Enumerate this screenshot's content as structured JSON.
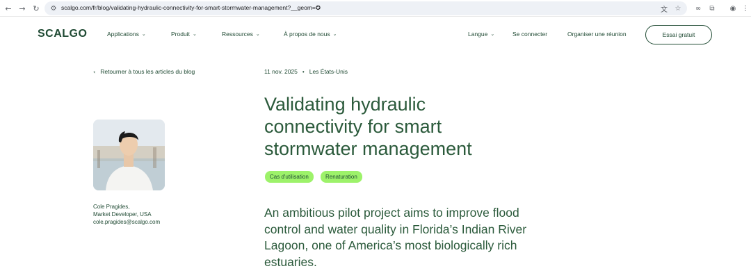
{
  "browser": {
    "url": "scalgo.com/fr/blog/validating-hydraulic-connectivity-for-smart-stormwater-management?__geom=✪",
    "icons": [
      "back-icon",
      "forward-icon",
      "reload-icon",
      "tune-icon",
      "translate-icon",
      "star-icon",
      "link-icon",
      "extensions-icon",
      "profile-icon",
      "menu-icon"
    ]
  },
  "header": {
    "logo": "SCALGO",
    "nav": [
      "Applications",
      "Produit",
      "Ressources",
      "À propos de nous"
    ],
    "language": "Langue",
    "login": "Se connecter",
    "meeting": "Organiser une réunion",
    "cta": "Essai gratuit"
  },
  "article": {
    "back_link": "Retourner à tous les articles du blog",
    "date": "11 nov. 2025",
    "separator": "•",
    "region": "Les États-Unis",
    "title_lines": [
      "Validating hydraulic",
      "connectivity for smart",
      "stormwater management"
    ],
    "tags": [
      "Cas d'utilisation",
      "Renaturation"
    ],
    "lead_lines": [
      "An ambitious pilot project aims to improve flood",
      "control and water quality in Florida’s Indian River",
      "Lagoon, one of America’s most biologically rich",
      "estuaries."
    ]
  },
  "author": {
    "name": "Cole Pragides,",
    "role": "Market Developer, USA",
    "email": "cole.pragides@scalgo.com"
  },
  "colors": {
    "brand_green": "#1f4a33",
    "tag_bg": "#9df26a",
    "omnibox_bg": "#eef1f6"
  }
}
